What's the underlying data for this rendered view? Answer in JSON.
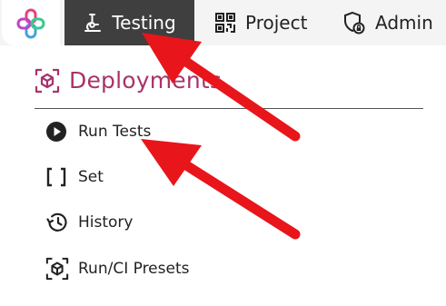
{
  "nav": {
    "logo_icon": "app-logo-icon",
    "items": [
      {
        "label": "Testing",
        "icon": "microscope-icon",
        "active": true
      },
      {
        "label": "Project",
        "icon": "qr-grid-icon",
        "active": false
      },
      {
        "label": "Admin",
        "icon": "shield-lock-icon",
        "active": false
      }
    ]
  },
  "section": {
    "title": "Deployments",
    "icon": "cube-bracket-icon"
  },
  "menu": [
    {
      "label": "Run Tests",
      "icon": "play-circle-icon"
    },
    {
      "label": "Set",
      "icon": "brackets-icon"
    },
    {
      "label": "History",
      "icon": "history-icon"
    },
    {
      "label": "Run/CI Presets",
      "icon": "cube-bracket-icon"
    }
  ],
  "annotations": {
    "arrow_color": "#e8151b"
  },
  "colors": {
    "accent": "#a8336a",
    "active_nav_bg": "#3f3f3f",
    "topbar_bg": "#f4f4f4"
  }
}
